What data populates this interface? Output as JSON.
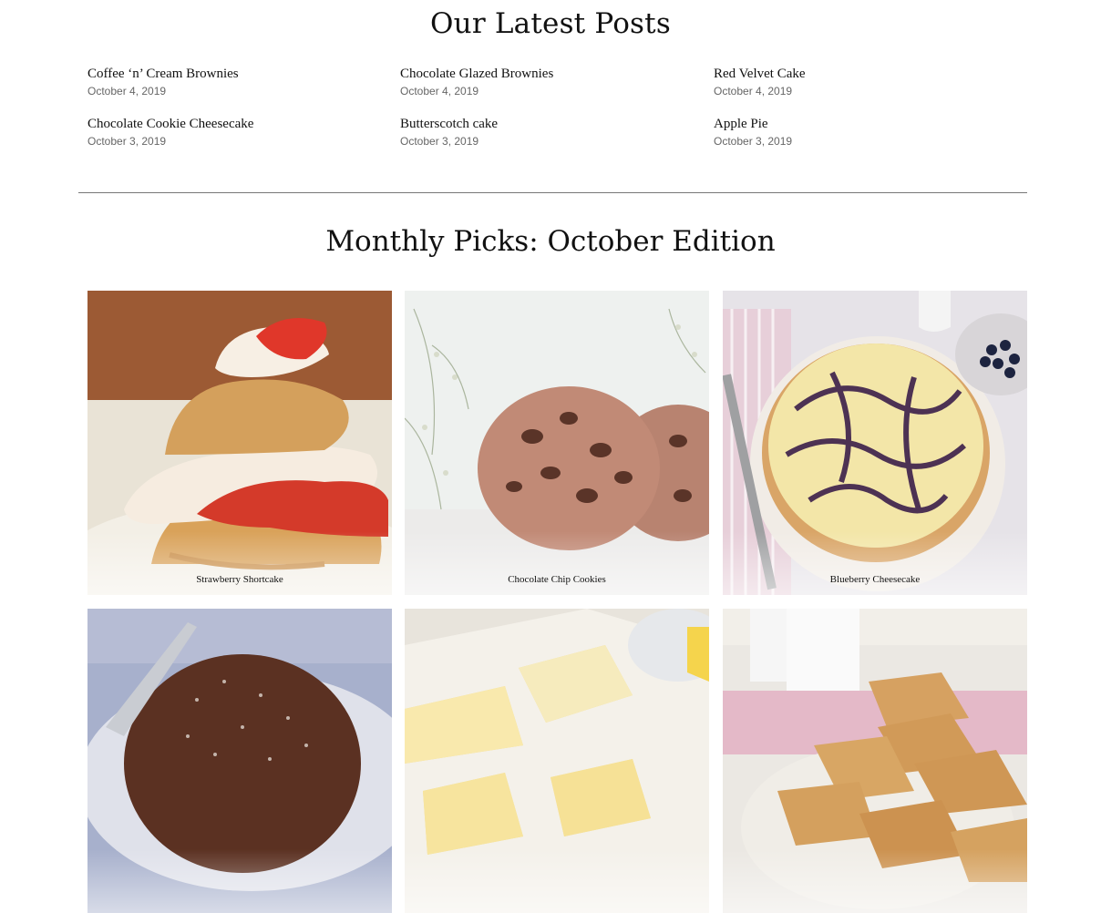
{
  "latest": {
    "title": "Our Latest Posts",
    "posts": [
      {
        "title": "Coffee ‘n’ Cream Brownies",
        "date": "October 4, 2019"
      },
      {
        "title": "Chocolate Glazed Brownies",
        "date": "October 4, 2019"
      },
      {
        "title": "Red Velvet Cake",
        "date": "October 4, 2019"
      },
      {
        "title": "Chocolate Cookie Cheesecake",
        "date": "October 3, 2019"
      },
      {
        "title": "Butterscotch cake",
        "date": "October 3, 2019"
      },
      {
        "title": "Apple Pie",
        "date": "October 3, 2019"
      }
    ]
  },
  "picks": {
    "title": "Monthly Picks: October Edition",
    "items": [
      {
        "caption": "Strawberry Shortcake",
        "image": "strawberry-shortcake-photo"
      },
      {
        "caption": "Chocolate Chip Cookies",
        "image": "chocolate-chip-cookies-photo"
      },
      {
        "caption": "Blueberry Cheesecake",
        "image": "blueberry-cheesecake-photo"
      },
      {
        "caption": "",
        "image": "chocolate-lava-cake-photo"
      },
      {
        "caption": "",
        "image": "lemon-bars-photo"
      },
      {
        "caption": "",
        "image": "blondie-bars-photo"
      }
    ]
  }
}
